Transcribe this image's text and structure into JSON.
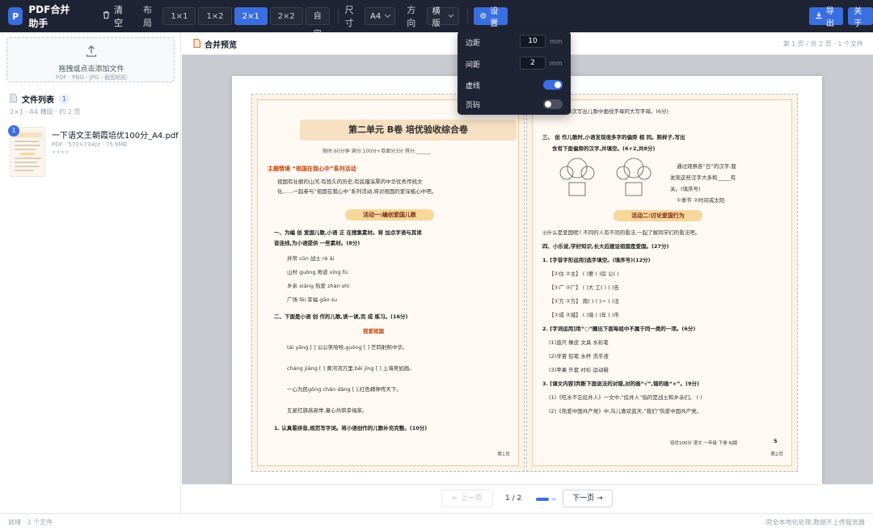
{
  "app": {
    "title": "PDF合并助手",
    "logo_letter": "P"
  },
  "toolbar": {
    "clear_label": "清空",
    "layout_label": "布局",
    "layout_options": [
      "1×1",
      "1×2",
      "2×1",
      "2×2",
      "自定义"
    ],
    "layout_active": "2×1",
    "size_label": "尺寸",
    "size_value": "A4",
    "orientation_label": "方向",
    "orientation_value": "横版",
    "settings_label": "设置",
    "export_label": "导出",
    "about_label": "关于"
  },
  "settings_popup": {
    "margin_label": "边距",
    "margin_value": "10",
    "margin_unit": "mm",
    "gap_label": "间距",
    "gap_value": "2",
    "gap_unit": "mm",
    "dashed_label": "虚线",
    "dashed_on": true,
    "page_number_label": "页码",
    "page_number_on": false
  },
  "sidebar": {
    "dropzone_title": "拖拽或点击添加文件",
    "dropzone_sub": "PDF · PNG · JPG · 截图粘贴",
    "file_list_title": "文件列表",
    "file_count": "1",
    "file_list_sub": "2×1 · A4 横版 · 约 2 页",
    "files": [
      {
        "index": "1",
        "name": "一下语文王朝霞培优100分_A4.pdf",
        "meta": "PDF · 570×794pt · 75.9MB",
        "stars": "★★★★"
      }
    ]
  },
  "preview": {
    "title": "合并预览",
    "info": "第 1 页 / 共 2 页 · 1 个文件",
    "left_page": {
      "title": "第二单元   B卷   培优验收综合卷",
      "meta": "限时:60分钟   满分:100分+卷面分3分   得分:______",
      "section": "主题情境 “祖国在我心中”系列活动",
      "intro1": "祖国有壮丽的山河,有悠久的历史,有底蕴深厚的中华优秀传统文",
      "intro2": "化……一起参与“祖国在我心中”系列活动,将对祖国的爱深植心中吧。",
      "activity": "活动一:编创爱国儿歌",
      "q1": "一、为编 创 爱国儿歌,小语 正 在搜集素材。将 加点字语与其读",
      "q1b": "音连线,为小语提供 一些素材。(8分)",
      "words": "井常     cūn        战士        rè ài",
      "words2": "山村     guǒng      奇迹        xīng fú",
      "words3": "乡亲     xiāng      热爱        zhàn shì",
      "words4": "广场     fēi        幸福        gāo su",
      "q2": "二、下面是小语 创 作的儿歌,读一读,完 成 练习。(16分)",
      "poem_title": "我爱祖国",
      "poem1": "tái yǎng [   ] 公公笑哈哈,guǒng [   ] 芒四射照中华。",
      "poem2": "cháng jiāng [   ] 黄河流万里,běi jīng [   ] 上海美如画。",
      "poem3": "一心为民gōng chǎn dǎng [   ],红色精神传天下。",
      "poem4": "五星红旗高高举,童心共筑幸福家。",
      "q3": "1. 认真看拼音,规范写字词。将小语创作的儿歌补充完整。(10分)",
      "footer": "第1页"
    },
    "right_page": {
      "l1": "2. 照样子,依次写出儿歌中画线字母的大写字母。(6分)",
      "l2": "三、 创 作儿歌时,小语发现很多字的偏旁 相 同。照样子,写出",
      "l3": "含有下面偏旁的汉字,并填空。(6+2,共8分)",
      "l4": "通过观察各“日”的汉字,我",
      "l5": "发现这些汉字大多和_____有",
      "l6": "关。(填序号)",
      "l7": "①季节     ②时间或太阳",
      "activity": "活动二:讨论爱国行为",
      "l8": "◎什么是爱国呢? 不同的人有不同的看法,一起了解同学们的看法吧。",
      "l9": "四、小乐说,学好知识,长大后建设祖国是爱国。(27分)",
      "l10": "1. [字音字形运用]选字填空。(填序号)(12分)",
      "l11": "【①住 ②主】 ( )要       ( )房       公( )",
      "l12": "【①广 ②厂】 ( )大       工( )       ( )告",
      "l13": "【①方 ②万】 南( )       ( )一       ( )法",
      "l14": "【①成 ②城】 ( )墙       ( )年       ( )市",
      "l15": "2. [字词运用]用“○”圈出下面每组中不属于同一类的一项。(6分)",
      "l16": "(1)直尺       橡皮       文具       水彩笔",
      "l17": "(2)牙膏       铅笔       水杯       洗手液",
      "l18": "(3)苹果       外套       衬衫       运动鞋",
      "l19": "3. [课文内容]判断下面说法的对错,对的画“√”,错的画“×”。(9分)",
      "l20": "(1)《吃水不忘挖井人》一文中,“挖井人”指的是战士和乡亲们。 ( )",
      "l21": "(2)《热爱中国共产党》中,鸟儿喜欢蓝天,“我们”热爱中国共产党。",
      "footer_brand": "培优100分  语文  一年级  下册  RJ版",
      "page_no": "5",
      "footer": "第2页"
    }
  },
  "nav": {
    "prev_label": "← 上一页",
    "page_indicator": "1 / 2",
    "next_label": "下一页 →"
  },
  "status": {
    "left": "就绪 · 1 个文件",
    "right": "完全本地化处理,数据不上传服务器"
  },
  "colors": {
    "accent": "#3b6fe0",
    "topbar": "#1f2434"
  }
}
